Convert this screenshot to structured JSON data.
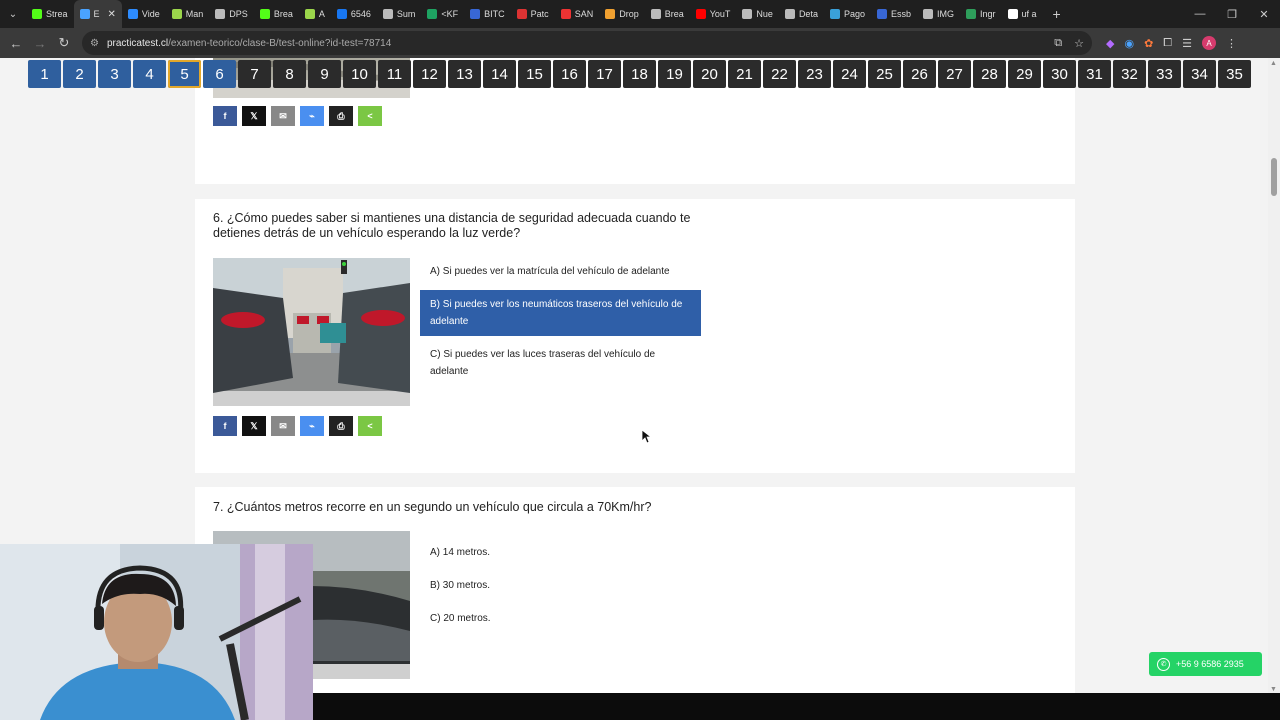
{
  "browser": {
    "tabs": [
      {
        "label": "Strea",
        "color": "#53fc18"
      },
      {
        "label": "E",
        "color": "#4aa3ff",
        "active": true
      },
      {
        "label": "Vide",
        "color": "#2d8cff"
      },
      {
        "label": "Man",
        "color": "#9bd64b"
      },
      {
        "label": "DPS",
        "color": "#bbbbbb"
      },
      {
        "label": "Brea",
        "color": "#53fc18"
      },
      {
        "label": "A",
        "color": "#9bd64b"
      },
      {
        "label": "6546",
        "color": "#1877f2"
      },
      {
        "label": "Sum",
        "color": "#bbbbbb"
      },
      {
        "label": "<KF",
        "color": "#1ea362"
      },
      {
        "label": "BITC",
        "color": "#3867d6"
      },
      {
        "label": "Patc",
        "color": "#d33"
      },
      {
        "label": "SAN",
        "color": "#e33"
      },
      {
        "label": "Drop",
        "color": "#f0a030"
      },
      {
        "label": "Brea",
        "color": "#bbbbbb"
      },
      {
        "label": "YouT",
        "color": "#ff0000"
      },
      {
        "label": "Nue",
        "color": "#bbbbbb"
      },
      {
        "label": "Deta",
        "color": "#bbbbbb"
      },
      {
        "label": "Pago",
        "color": "#3aa0d8"
      },
      {
        "label": "Essb",
        "color": "#3867d6"
      },
      {
        "label": "IMG",
        "color": "#bbbbbb"
      },
      {
        "label": "Ingr",
        "color": "#2e9e5b"
      },
      {
        "label": "uf a",
        "color": "#ffffff"
      }
    ],
    "url_host": "practicatest.cl",
    "url_path": "/examen-teorico/clase-B/test-online?id-test=78714"
  },
  "question_nav": {
    "numbers": [
      "1",
      "2",
      "3",
      "4",
      "5",
      "6",
      "7",
      "8",
      "9",
      "10",
      "11",
      "12",
      "13",
      "14",
      "15",
      "16",
      "17",
      "18",
      "19",
      "20",
      "21",
      "22",
      "23",
      "24",
      "25",
      "26",
      "27",
      "28",
      "29",
      "30",
      "31",
      "32",
      "33",
      "34",
      "35"
    ],
    "answered": [
      "1",
      "2",
      "3",
      "4",
      "6"
    ],
    "current": "5"
  },
  "questions": [
    {
      "title": "6. ¿Cómo puedes saber si mantienes una distancia de seguridad adecuada cuando te detienes detrás de un vehículo esperando la luz verde?",
      "options": [
        "A) Si puedes ver la matrícula del vehículo de adelante",
        "B) Si puedes ver los neumáticos traseros del vehículo de adelante",
        "C) Si puedes ver las luces traseras del vehículo de adelante"
      ],
      "selected": 1
    },
    {
      "title": "7. ¿Cuántos metros recorre en un segundo un vehículo que circula a 70Km/hr?",
      "options": [
        "A) 14 metros.",
        "B) 30 metros.",
        "C) 20 metros."
      ]
    }
  ],
  "share_icons": {
    "facebook": "f",
    "twitter": "𝕏",
    "email": "✉",
    "messenger": "⌁",
    "print": "⎙",
    "share": "<"
  },
  "whatsapp": {
    "phone": "+56 9 6586 2935",
    "color": "#25d366"
  },
  "colors": {
    "selected_option": "#2f5fa8",
    "answered_nav": "#2f5f9e",
    "current_outline": "#e2a72a"
  }
}
